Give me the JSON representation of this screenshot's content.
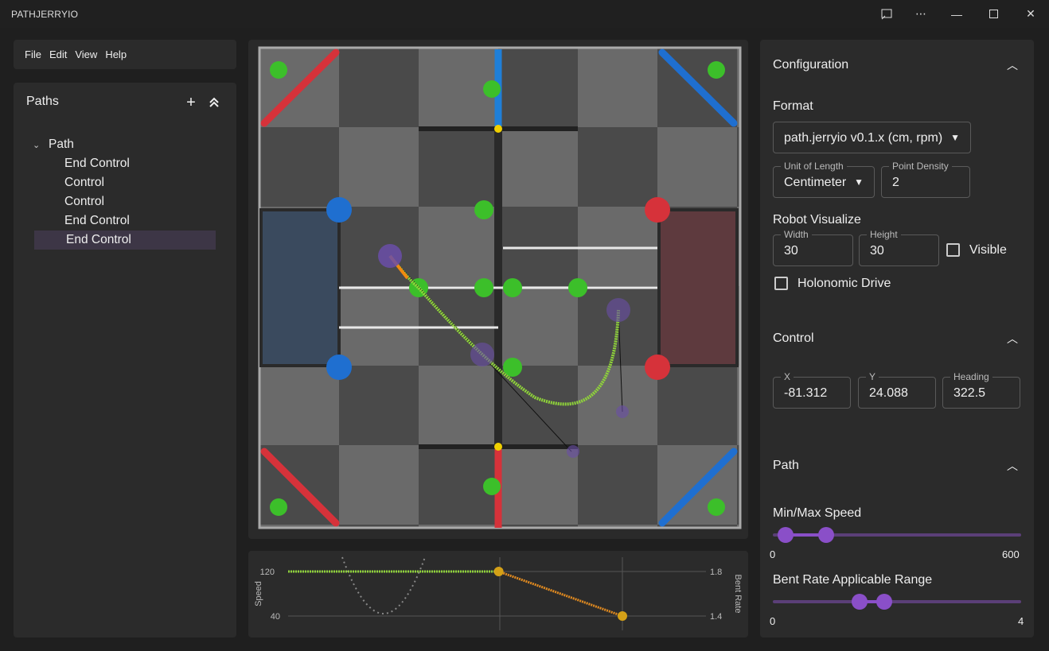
{
  "app": {
    "title": "PATHJERRYIO"
  },
  "window_controls": [
    "cast-icon",
    "more-icon",
    "minimize-icon",
    "maximize-icon",
    "close-icon"
  ],
  "menu": {
    "items": [
      "File",
      "Edit",
      "View",
      "Help"
    ]
  },
  "paths_panel": {
    "title": "Paths",
    "tree": {
      "path_label": "Path",
      "children": [
        "End Control",
        "Control",
        "Control",
        "End Control",
        "End Control"
      ],
      "selected_index": 4
    }
  },
  "speed_chart": {
    "left_axis_label": "Speed",
    "right_axis_label": "Bent Rate",
    "left_ticks": [
      "120",
      "40"
    ],
    "right_ticks": [
      "1.8",
      "1.4"
    ]
  },
  "chart_data": {
    "type": "line",
    "series": [
      {
        "values": [
          [
            0,
            120
          ],
          [
            0.63,
            120
          ],
          [
            1.0,
            40
          ]
        ]
      }
    ]
  },
  "configuration": {
    "title": "Configuration",
    "format_label": "Format",
    "format_value": "path.jerryio v0.1.x (cm, rpm)",
    "unit_label": "Unit of Length",
    "unit_value": "Centimeter",
    "density_label": "Point Density",
    "density_value": "2",
    "robot_label": "Robot Visualize",
    "width_label": "Width",
    "width_value": "30",
    "height_label": "Height",
    "height_value": "30",
    "visible_label": "Visible",
    "holonomic_label": "Holonomic Drive"
  },
  "control": {
    "title": "Control",
    "x_label": "X",
    "x_value": "-81.312",
    "y_label": "Y",
    "y_value": "24.088",
    "heading_label": "Heading",
    "heading_value": "322.5"
  },
  "path_section": {
    "title": "Path",
    "speed_label": "Min/Max Speed",
    "speed_min_label": "0",
    "speed_max_label": "600",
    "speed_range": [
      30,
      128
    ],
    "bent_label": "Bent Rate Applicable Range",
    "bent_min_label": "0",
    "bent_max_label": "4",
    "bent_range": [
      1.4,
      1.8
    ]
  },
  "colors": {
    "accent": "#8a4fc8",
    "path": "#8fd33a",
    "panel": "#2b2b2b"
  }
}
